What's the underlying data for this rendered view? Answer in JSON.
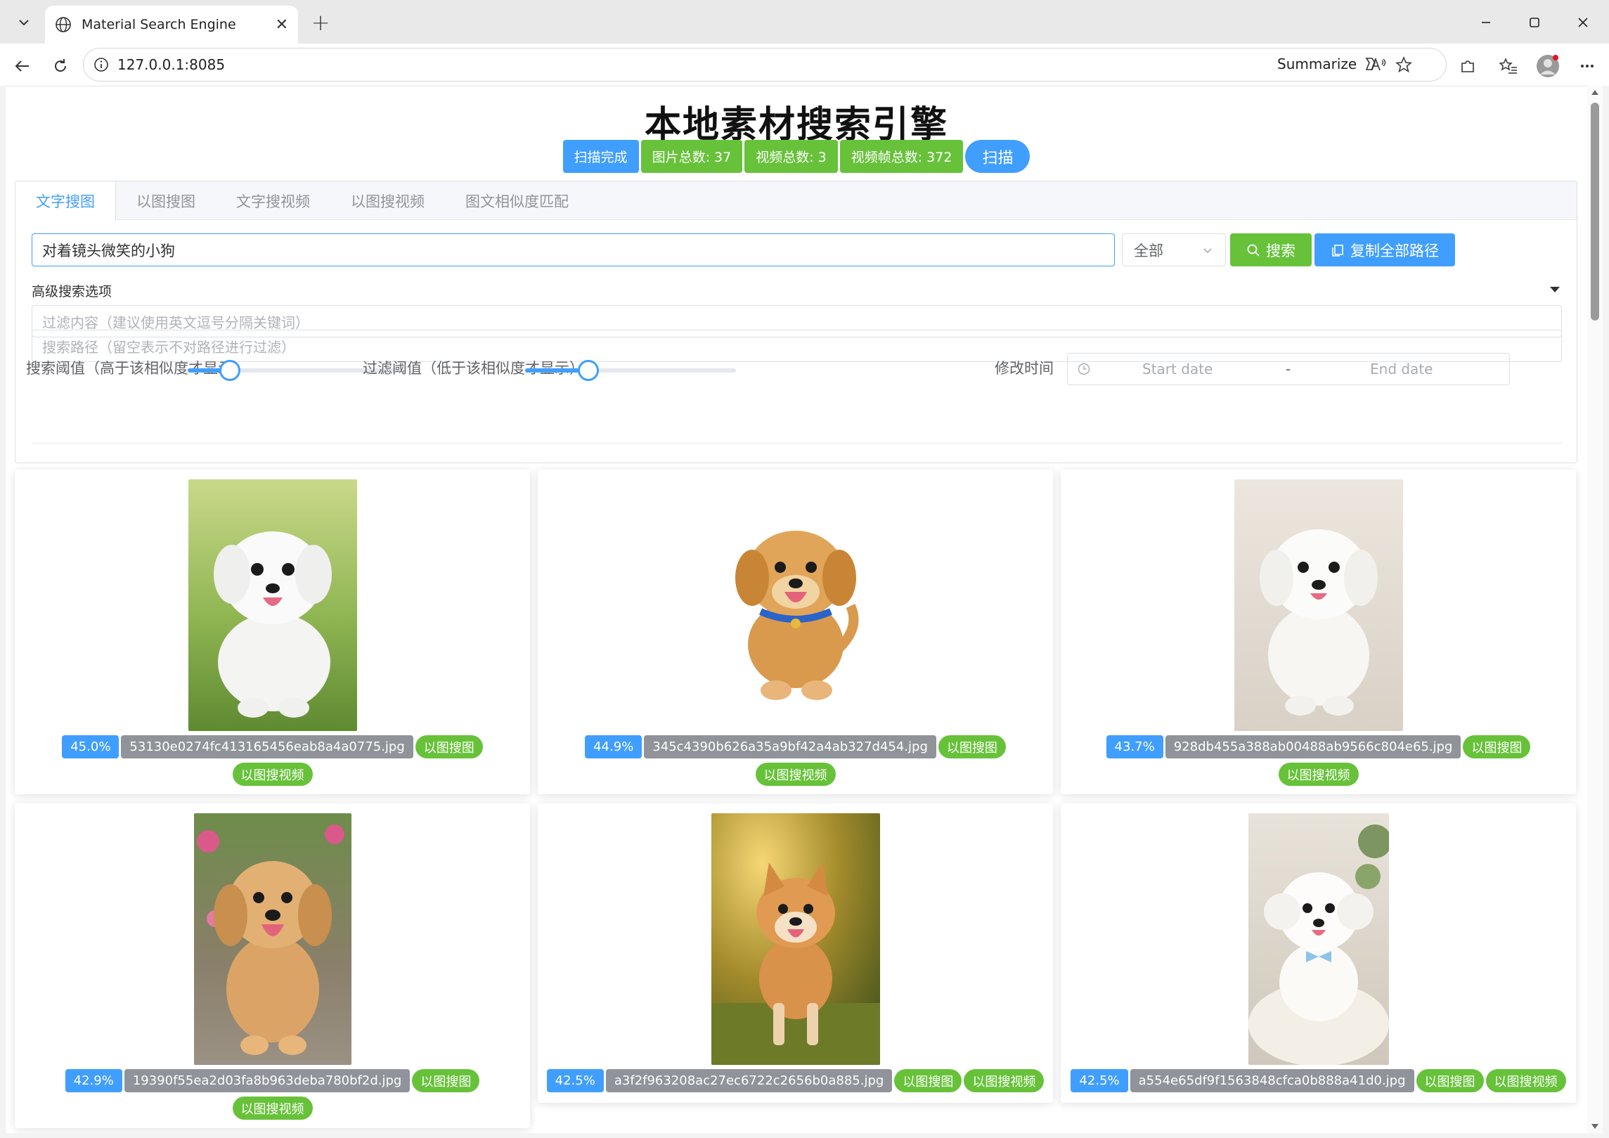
{
  "browser": {
    "tab_title": "Material Search Engine",
    "url": "127.0.0.1:8085",
    "summarize_label": "Summarize"
  },
  "page": {
    "title": "本地素材搜索引擎",
    "status": {
      "scan_status": "扫描完成",
      "image_total": "图片总数: 37",
      "video_total": "视频总数: 3",
      "frame_total": "视频帧总数: 372",
      "scan_button": "扫描"
    },
    "tabs": [
      "文字搜图",
      "以图搜图",
      "文字搜视频",
      "以图搜视频",
      "图文相似度匹配"
    ],
    "active_tab": 0,
    "search": {
      "query": "对着镜头微笑的小狗",
      "scope": "全部",
      "search_label": "搜索",
      "copy_label": "复制全部路径"
    },
    "advanced": {
      "title": "高级搜索选项",
      "filter_placeholder": "过滤内容（建议使用英文逗号分隔关键词）",
      "path_placeholder": "搜索路径（留空表示不对路径进行过滤）",
      "search_threshold_label": "搜索阈值（高于该相似度才显示）",
      "search_threshold": 0.2,
      "filter_threshold_label": "过滤阈值（低于该相似度才显示）",
      "filter_threshold": 0.3,
      "modified_label": "修改时间",
      "start_date": "Start date",
      "date_sep": "-",
      "end_date": "End date"
    },
    "results": [
      {
        "score": "45.0%",
        "file": "53130e0274fc413165456eab8a4a0775.jpg",
        "actions": [
          "以图搜图",
          "以图搜视频"
        ]
      },
      {
        "score": "44.9%",
        "file": "345c4390b626a35a9bf42a4ab327d454.jpg",
        "actions": [
          "以图搜图",
          "以图搜视频"
        ]
      },
      {
        "score": "43.7%",
        "file": "928db455a388ab00488ab9566c804e65.jpg",
        "actions": [
          "以图搜图",
          "以图搜视频"
        ]
      },
      {
        "score": "42.9%",
        "file": "19390f55ea2d03fa8b963deba780bf2d.jpg",
        "actions": [
          "以图搜图",
          "以图搜视频"
        ]
      },
      {
        "score": "42.5%",
        "file": "a3f2f963208ac27ec6722c2656b0a885.jpg",
        "actions": [
          "以图搜图",
          "以图搜视频"
        ]
      },
      {
        "score": "42.5%",
        "file": "a554e65df9f1563848cfca0b888a41d0.jpg",
        "actions": [
          "以图搜图",
          "以图搜视频"
        ]
      }
    ]
  },
  "colors": {
    "primary": "#409eff",
    "success": "#67c23a",
    "info": "#909399"
  }
}
